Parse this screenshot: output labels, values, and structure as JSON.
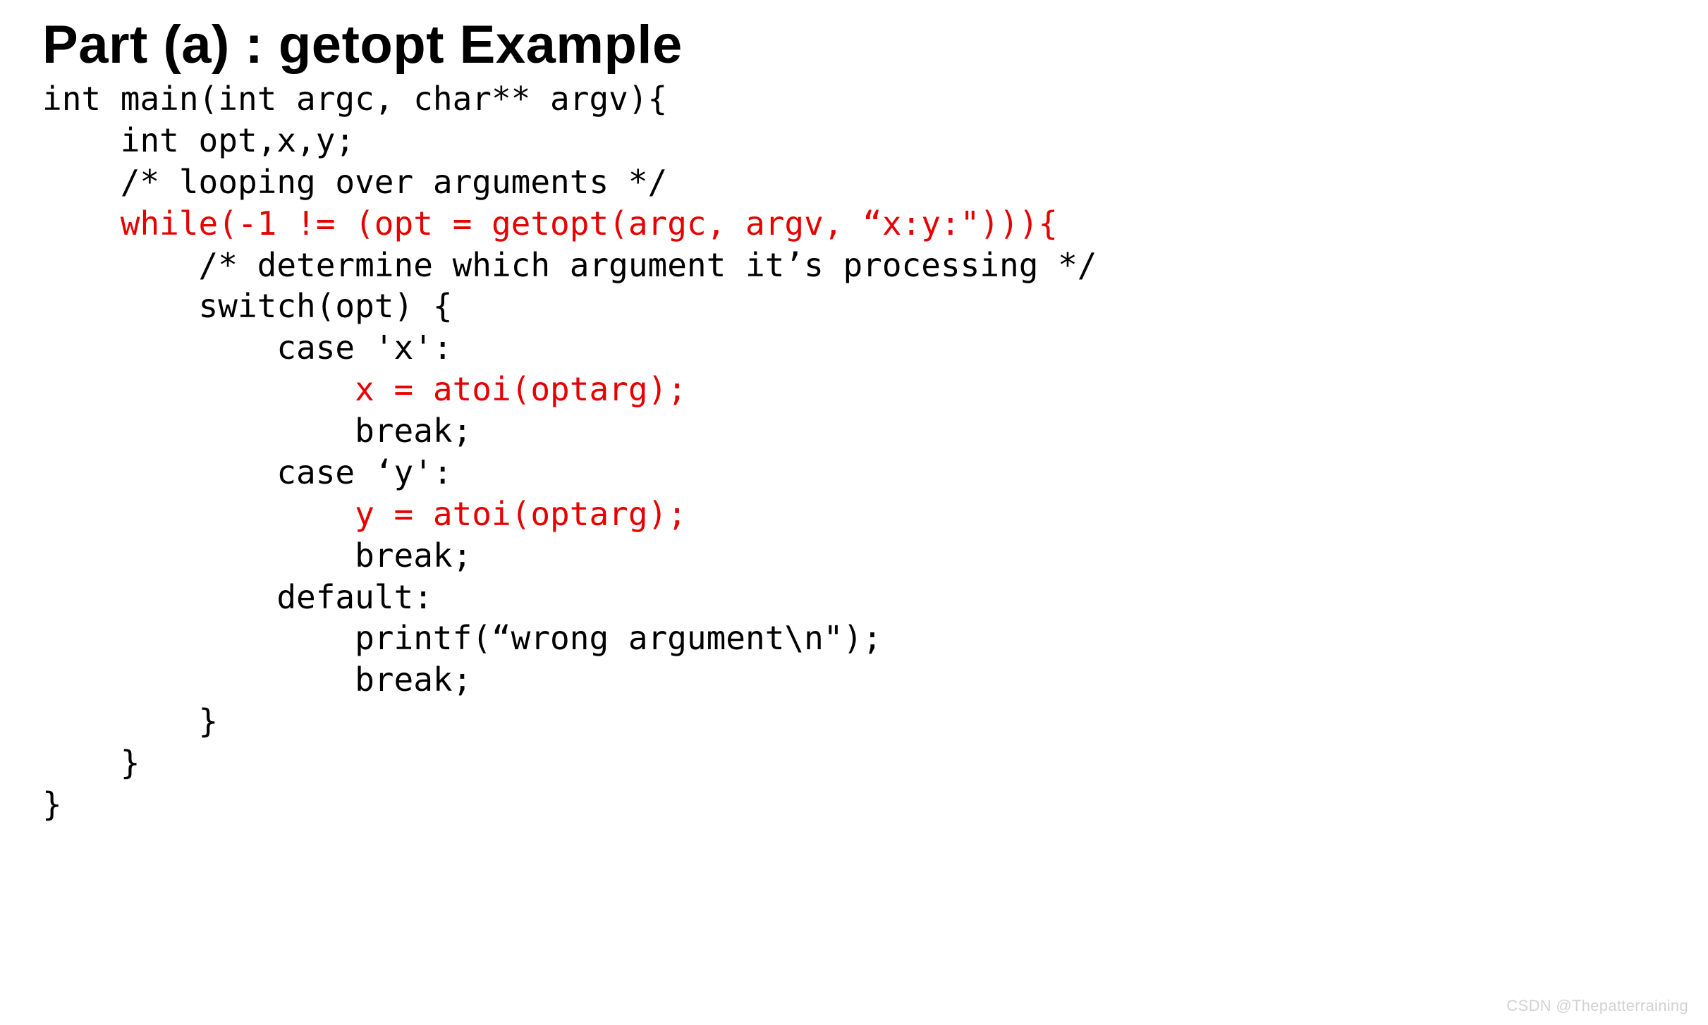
{
  "title": "Part (a) : getopt Example",
  "code": {
    "l01": "int main(int argc, char** argv){",
    "l02": "    int opt,x,y;",
    "l03": "    /* looping over arguments */",
    "l04": "    while(-1 != (opt = getopt(argc, argv, “x:y:\"))){",
    "l05": "        /* determine which argument it’s processing */",
    "l06": "        switch(opt) {",
    "l07": "            case 'x':",
    "l08": "                x = atoi(optarg);",
    "l09": "                break;",
    "l10": "            case ‘y':",
    "l11": "                y = atoi(optarg);",
    "l12": "                break;",
    "l13": "            default:",
    "l14": "                printf(“wrong argument\\n\");",
    "l15": "                break;",
    "l16": "        }",
    "l17": "    }",
    "l18": "}"
  },
  "watermark": "CSDN @Thepatterraining"
}
